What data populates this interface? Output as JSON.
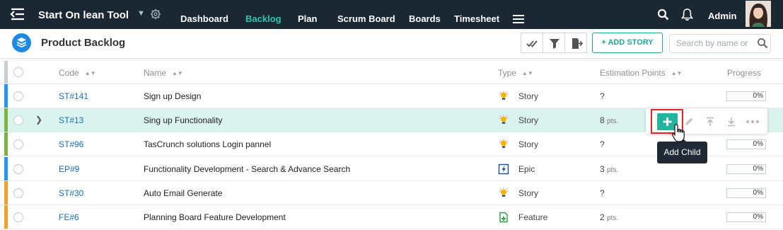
{
  "app": {
    "title": "Start On lean Tool",
    "nav": [
      {
        "label": "Dashboard",
        "active": false
      },
      {
        "label": "Backlog",
        "active": true
      },
      {
        "label": "Plan",
        "active": false
      },
      {
        "label": "Scrum Board",
        "active": false
      },
      {
        "label": "Boards",
        "active": false
      },
      {
        "label": "Timesheet",
        "active": false
      }
    ],
    "user": "Admin"
  },
  "subheader": {
    "title": "Product Backlog",
    "add_story_label": "+ ADD STORY",
    "search_placeholder": "Search by name or"
  },
  "table": {
    "columns": {
      "code": "Code",
      "name": "Name",
      "type": "Type",
      "estimation": "Estimation Points",
      "progress": "Progress"
    },
    "rows": [
      {
        "code": "ST#141",
        "name": "Sign up Design",
        "type": "Story",
        "type_icon": "lightbulb-icon",
        "est_value": "?",
        "est_unit": "",
        "progress": "0%",
        "bar_color": "#2196f3",
        "expandable": false,
        "highlighted": false
      },
      {
        "code": "ST#13",
        "name": "Sing up Functionality",
        "type": "Story",
        "type_icon": "lightbulb-icon",
        "est_value": "8",
        "est_unit": "pts.",
        "progress": "0%",
        "bar_color": "#7cb342",
        "expandable": true,
        "highlighted": true
      },
      {
        "code": "ST#96",
        "name": "TasCrunch solutions Login pannel",
        "type": "Story",
        "type_icon": "lightbulb-icon",
        "est_value": "?",
        "est_unit": "",
        "progress": "0%",
        "bar_color": "#7cb342",
        "expandable": false,
        "highlighted": false
      },
      {
        "code": "EP#9",
        "name": "Functionality Development - Search & Advance Search",
        "type": "Epic",
        "type_icon": "lightning-icon",
        "est_value": "3",
        "est_unit": "pts.",
        "progress": "0%",
        "bar_color": "#2196f3",
        "expandable": false,
        "highlighted": false
      },
      {
        "code": "ST#30",
        "name": "Auto Email Generate",
        "type": "Story",
        "type_icon": "lightbulb-icon",
        "est_value": "?",
        "est_unit": "",
        "progress": "0%",
        "bar_color": "#f0a030",
        "expandable": false,
        "highlighted": false
      },
      {
        "code": "FE#6",
        "name": "Planning Board Feature Development",
        "type": "Feature",
        "type_icon": "feature-doc-icon",
        "est_value": "2",
        "est_unit": "pts.",
        "progress": "0%",
        "bar_color": "#f0a030",
        "expandable": false,
        "highlighted": false
      }
    ]
  },
  "row_actions": {
    "tooltip": "Add Child",
    "icons": [
      "plus-icon",
      "pencil-icon",
      "move-top-icon",
      "move-bottom-icon",
      "more-icon"
    ]
  }
}
